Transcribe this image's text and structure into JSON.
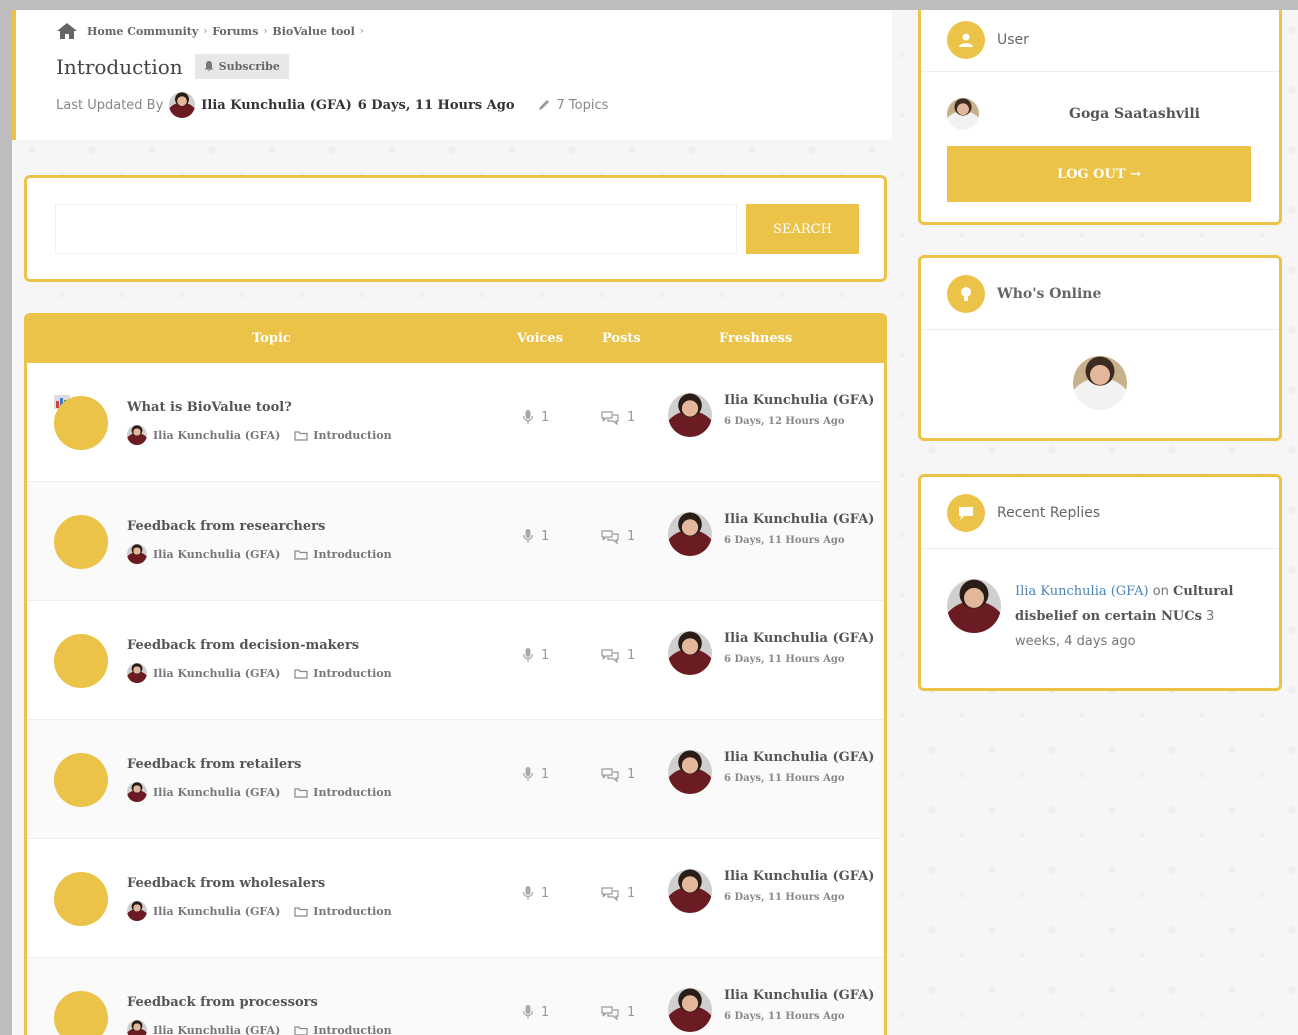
{
  "breadcrumb": {
    "home": "Home Community",
    "forums": "Forums",
    "current": "BioValue tool"
  },
  "page": {
    "title": "Introduction",
    "subscribe_label": "Subscribe",
    "last_updated_label": "Last Updated By",
    "last_updated_author": "Ilia Kunchulia (GFA)",
    "last_updated_time": "6 Days, 11 Hours Ago",
    "topics_count": "7 Topics"
  },
  "search": {
    "placeholder": "",
    "button_label": "SEARCH"
  },
  "table": {
    "headers": {
      "topic": "Topic",
      "voices": "Voices",
      "posts": "Posts",
      "freshness": "Freshness"
    },
    "rows": [
      {
        "title": "What is BioValue tool?",
        "author": "Ilia Kunchulia (GFA)",
        "forum": "Introduction",
        "voices": "1",
        "posts": "1",
        "fresh_author": "Ilia Kunchulia (GFA)",
        "fresh_time": "6 Days, 12 Hours Ago"
      },
      {
        "title": "Feedback from researchers",
        "author": "Ilia Kunchulia (GFA)",
        "forum": "Introduction",
        "voices": "1",
        "posts": "1",
        "fresh_author": "Ilia Kunchulia (GFA)",
        "fresh_time": "6 Days, 11 Hours Ago"
      },
      {
        "title": "Feedback from decision-makers",
        "author": "Ilia Kunchulia (GFA)",
        "forum": "Introduction",
        "voices": "1",
        "posts": "1",
        "fresh_author": "Ilia Kunchulia (GFA)",
        "fresh_time": "6 Days, 11 Hours Ago"
      },
      {
        "title": "Feedback from retailers",
        "author": "Ilia Kunchulia (GFA)",
        "forum": "Introduction",
        "voices": "1",
        "posts": "1",
        "fresh_author": "Ilia Kunchulia (GFA)",
        "fresh_time": "6 Days, 11 Hours Ago"
      },
      {
        "title": "Feedback from wholesalers",
        "author": "Ilia Kunchulia (GFA)",
        "forum": "Introduction",
        "voices": "1",
        "posts": "1",
        "fresh_author": "Ilia Kunchulia (GFA)",
        "fresh_time": "6 Days, 11 Hours Ago"
      },
      {
        "title": "Feedback from processors",
        "author": "Ilia Kunchulia (GFA)",
        "forum": "Introduction",
        "voices": "1",
        "posts": "1",
        "fresh_author": "Ilia Kunchulia (GFA)",
        "fresh_time": "6 Days, 11 Hours Ago"
      }
    ]
  },
  "sidebar": {
    "user": {
      "title": "User",
      "name": "Goga Saatashvili",
      "logout_label": "LOG OUT →"
    },
    "online": {
      "title": "Who's Online"
    },
    "replies": {
      "title": "Recent Replies",
      "author": "Ilia Kunchulia (GFA)",
      "on": "on",
      "topic": "Cultural disbelief on certain NUCs",
      "time": "3 weeks, 4 days ago"
    }
  },
  "colors": {
    "accent": "#ebc348",
    "link": "#4a84b8"
  },
  "icons": {
    "home": "home-icon",
    "bell": "bell-icon",
    "pencil": "pencil-icon",
    "mic": "microphone-icon",
    "comments": "comments-icon",
    "folder": "folder-icon",
    "user": "user-icon",
    "online": "lightbulb-icon",
    "replies": "chat-bubble-icon"
  }
}
